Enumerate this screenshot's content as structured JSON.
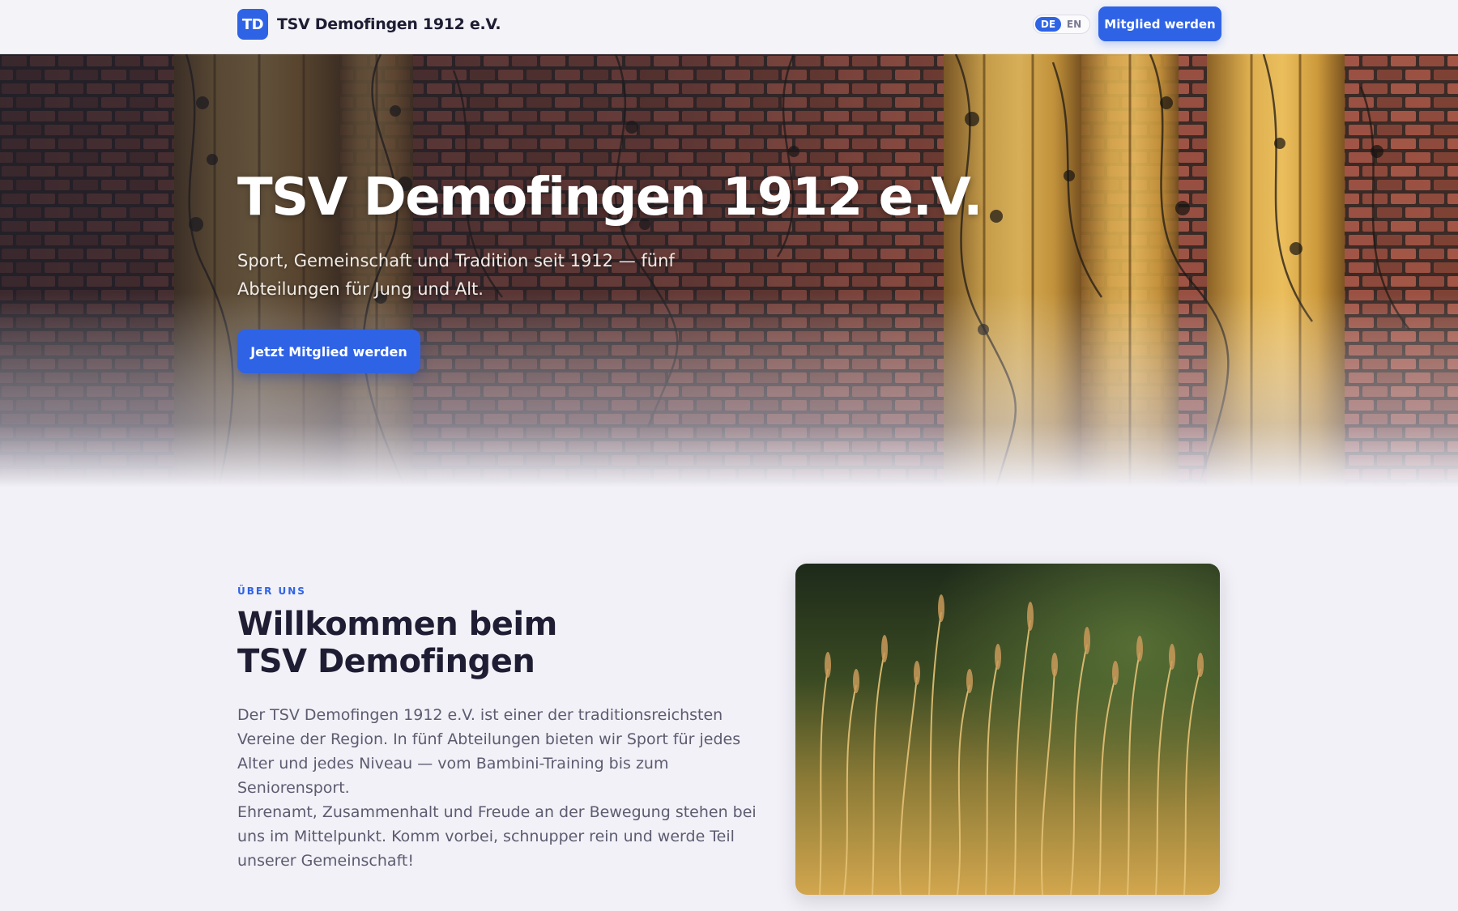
{
  "header": {
    "logo_initials": "TD",
    "brand_name": "TSV Demofingen 1912 e.V.",
    "languages": [
      "DE",
      "EN"
    ],
    "active_language": "DE",
    "cta_label": "Mitglied werden"
  },
  "hero": {
    "title": "TSV Demofingen 1912 e.V.",
    "subtitle": "Sport, Gemeinschaft und Tradition seit 1912 — fünf Abteilungen für Jung und Alt.",
    "cta_label": "Jetzt Mitglied werden"
  },
  "about": {
    "eyebrow": "ÜBER UNS",
    "title_line1": "Willkommen beim",
    "title_line2": "TSV Demofingen",
    "paragraph1": "Der TSV Demofingen 1912 e.V. ist einer der traditionsreichsten Vereine der Region. In fünf Abteilungen bieten wir Sport für jedes Alter und jedes Niveau — vom Bambini-Training bis zum Seniorensport.",
    "paragraph2": "Ehrenamt, Zusammenhalt und Freude an der Bewegung stehen bei uns im Mittelpunkt. Komm vorbei, schnupper rein und werde Teil unserer Gemeinschaft!"
  },
  "colors": {
    "accent": "#2f63e6",
    "page_background": "#f2f1f7",
    "heading": "#1e1d33",
    "body_text": "#5c5b70"
  }
}
